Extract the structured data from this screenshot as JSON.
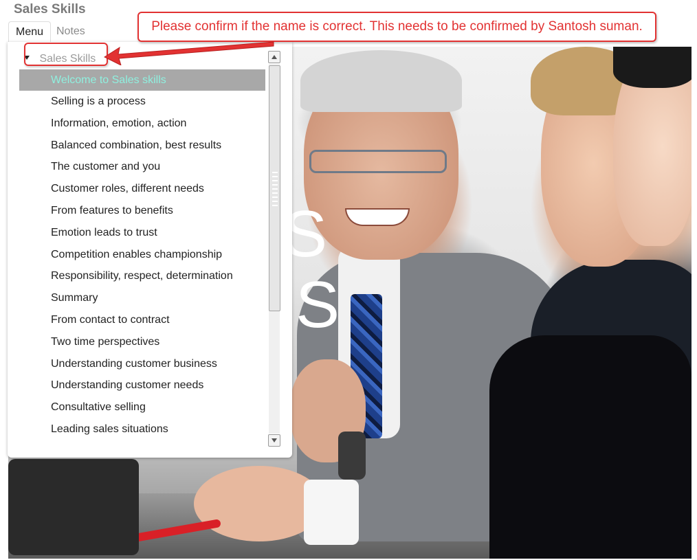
{
  "app": {
    "title": "Sales Skills"
  },
  "tabs": [
    {
      "label": "Menu",
      "active": true
    },
    {
      "label": "Notes",
      "active": false
    }
  ],
  "menu": {
    "root_label": "Sales Skills",
    "items": [
      {
        "label": "Welcome to Sales skills",
        "active": true
      },
      {
        "label": "Selling is a process"
      },
      {
        "label": "Information, emotion, action"
      },
      {
        "label": "Balanced combination, best results"
      },
      {
        "label": "The customer and you"
      },
      {
        "label": "Customer roles, different needs"
      },
      {
        "label": "From features to benefits"
      },
      {
        "label": "Emotion leads to trust"
      },
      {
        "label": "Competition enables championship"
      },
      {
        "label": "Responsibility, respect, determination"
      },
      {
        "label": "Summary"
      },
      {
        "label": "From contact to contract"
      },
      {
        "label": "Two time perspectives"
      },
      {
        "label": "Understanding customer business"
      },
      {
        "label": "Understanding customer needs"
      },
      {
        "label": "Consultative selling"
      },
      {
        "label": "Leading sales situations"
      }
    ]
  },
  "hero": {
    "letter_1": "S",
    "letter_2": "S"
  },
  "annotation": {
    "text": "Please confirm if the name is correct. This needs to be confirmed by Santosh suman.",
    "color": "#e23232"
  },
  "colors": {
    "active_item_bg": "#a8a8a8",
    "active_item_text": "#8ff0df"
  }
}
